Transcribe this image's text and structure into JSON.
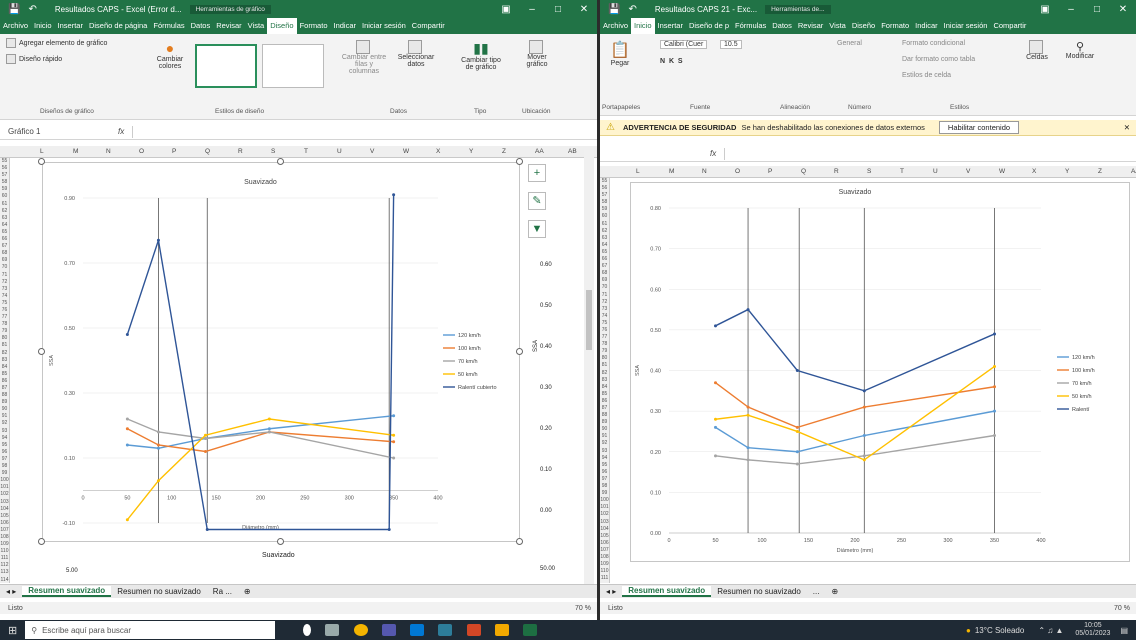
{
  "left": {
    "title": "Resultados CAPS - Excel (Error d...",
    "context_tab": "Herramientas de gráfico",
    "menu": [
      "Archivo",
      "Inicio",
      "Insertar",
      "Diseño de página",
      "Fórmulas",
      "Datos",
      "Revisar",
      "Vista",
      "Diseño",
      "Formato",
      "Indicar",
      "Iniciar sesión",
      "Compartir"
    ],
    "ribbon": {
      "add_element": "Agregar elemento de gráfico",
      "quick_layout": "Diseño rápido",
      "change_colors": "Cambiar colores",
      "switch_rowcol": "Cambiar entre filas y columnas",
      "select_data": "Seleccionar datos",
      "change_type": "Cambiar tipo de gráfico",
      "move_chart": "Mover gráfico",
      "groups": [
        "Diseños de gráfico",
        "Estilos de diseño",
        "Datos",
        "Tipo",
        "Ubicación"
      ]
    },
    "namebox": "Gráfico 1",
    "fx": "fx",
    "columns": [
      "L",
      "M",
      "N",
      "O",
      "P",
      "Q",
      "R",
      "S",
      "T",
      "U",
      "V",
      "W",
      "X",
      "Y",
      "Z",
      "AA",
      "AB"
    ],
    "rows_first": 55,
    "chart_title": "Suavizado",
    "x_label": "Diámetro (mm)",
    "legend": [
      "120 km/h",
      "100 km/h",
      "70 km/h",
      "50 km/h",
      "Ralentí cubierto"
    ],
    "second_title": "Suavizado",
    "second_tick": "5.00",
    "right_ticks": [
      "0.60",
      "0.50",
      "0.40",
      "0.30",
      "0.20",
      "0.10",
      "0.00"
    ],
    "right_axis_label": "SSA",
    "right_bottom": "50.00",
    "tabs": [
      "Resumen suavizado",
      "Resumen no suavizado",
      "Ra ..."
    ],
    "status": "Listo",
    "zoom": "70 %"
  },
  "right": {
    "title": "Resultados CAPS 21 - Exc...",
    "context_tab": "Herramientas de...",
    "menu": [
      "Archivo",
      "Inicio",
      "Insertar",
      "Diseño de p",
      "Fórmulas",
      "Datos",
      "Revisar",
      "Vista",
      "Diseño",
      "Formato",
      "Indicar",
      "Iniciar sesión",
      "Compartir"
    ],
    "ribbon": {
      "paste": "Pegar",
      "font": "Calibri (Cuer",
      "size": "10.5",
      "format_general": "General",
      "cond_format": "Formato condicional",
      "table_format": "Dar formato como tabla",
      "cell_styles": "Estilos de celda",
      "cells": "Celdas",
      "edit": "Modificar",
      "groups": [
        "Portapapeles",
        "Fuente",
        "Alineación",
        "Número",
        "Estilos"
      ]
    },
    "warning_label": "ADVERTENCIA DE SEGURIDAD",
    "warning_text": "Se han deshabilitado las conexiones de datos externos",
    "warning_button": "Habilitar contenido",
    "columns": [
      "L",
      "M",
      "N",
      "O",
      "P",
      "Q",
      "R",
      "S",
      "T",
      "U",
      "V",
      "W",
      "X",
      "Y",
      "Z",
      "AA"
    ],
    "rows_first": 55,
    "chart_title": "Suavizado",
    "x_label": "Diámetro (mm)",
    "y_label": "SSA",
    "legend": [
      "120 km/h",
      "100 km/h",
      "70 km/h",
      "50 km/h",
      "Ralentí"
    ],
    "tabs": [
      "Resumen suavizado",
      "Resumen no suavizado",
      "..."
    ],
    "status": "Listo",
    "zoom": "70 %"
  },
  "taskbar": {
    "search": "Escribe aquí para buscar",
    "weather": "13°C Soleado",
    "time": "10:05",
    "date": "05/01/2023"
  },
  "chart_data": [
    {
      "type": "line",
      "title": "Suavizado",
      "xlabel": "Diámetro (mm)",
      "ylabel": "SSA",
      "xlim": [
        0,
        400
      ],
      "ylim": [
        -0.1,
        0.9
      ],
      "x_ticks": [
        0,
        50,
        100,
        150,
        200,
        250,
        300,
        350,
        400
      ],
      "y_ticks": [
        -0.1,
        0.1,
        0.3,
        0.5,
        0.7,
        0.9
      ],
      "series": [
        {
          "name": "120 km/h",
          "color": "#5b9bd5",
          "x": [
            50,
            85,
            138,
            210,
            350
          ],
          "y": [
            0.14,
            0.13,
            0.16,
            0.19,
            0.23
          ]
        },
        {
          "name": "100 km/h",
          "color": "#ed7d31",
          "x": [
            50,
            85,
            138,
            210,
            350
          ],
          "y": [
            0.19,
            0.14,
            0.12,
            0.18,
            0.15
          ]
        },
        {
          "name": "70 km/h",
          "color": "#a5a5a5",
          "x": [
            50,
            85,
            138,
            210,
            350
          ],
          "y": [
            0.22,
            0.18,
            0.16,
            0.18,
            0.1
          ]
        },
        {
          "name": "50 km/h",
          "color": "#ffc000",
          "x": [
            50,
            85,
            138,
            210,
            350
          ],
          "y": [
            -0.09,
            0.03,
            0.17,
            0.22,
            0.17
          ]
        },
        {
          "name": "Ralentí cubierto",
          "color": "#2f5597",
          "x": [
            50,
            85,
            140,
            345,
            350
          ],
          "y": [
            0.48,
            0.77,
            -0.12,
            -0.12,
            0.91
          ]
        }
      ]
    },
    {
      "type": "line",
      "title": "Suavizado",
      "xlabel": "Diámetro (mm)",
      "ylabel": "SSA",
      "xlim": [
        0,
        400
      ],
      "ylim": [
        0.0,
        0.8
      ],
      "x_ticks": [
        0,
        50,
        100,
        150,
        200,
        250,
        300,
        350,
        400
      ],
      "y_ticks": [
        0.0,
        0.1,
        0.2,
        0.3,
        0.4,
        0.5,
        0.6,
        0.7,
        0.8
      ],
      "series": [
        {
          "name": "120 km/h",
          "color": "#5b9bd5",
          "x": [
            50,
            85,
            138,
            210,
            350
          ],
          "y": [
            0.26,
            0.21,
            0.2,
            0.24,
            0.3
          ]
        },
        {
          "name": "100 km/h",
          "color": "#ed7d31",
          "x": [
            50,
            85,
            138,
            210,
            350
          ],
          "y": [
            0.37,
            0.31,
            0.26,
            0.31,
            0.36
          ]
        },
        {
          "name": "70 km/h",
          "color": "#a5a5a5",
          "x": [
            50,
            85,
            138,
            210,
            350
          ],
          "y": [
            0.19,
            0.18,
            0.17,
            0.19,
            0.24
          ]
        },
        {
          "name": "50 km/h",
          "color": "#ffc000",
          "x": [
            50,
            85,
            138,
            210,
            350
          ],
          "y": [
            0.28,
            0.29,
            0.25,
            0.18,
            0.41
          ]
        },
        {
          "name": "Ralentí",
          "color": "#2f5597",
          "x": [
            50,
            85,
            138,
            210,
            350
          ],
          "y": [
            0.51,
            0.55,
            0.4,
            0.35,
            0.49
          ]
        }
      ]
    }
  ]
}
